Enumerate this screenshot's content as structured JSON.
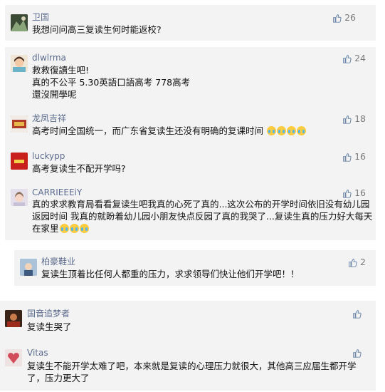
{
  "comments": [
    {
      "user": "卫国",
      "text": [
        "我想问问高三复读生何时能返校?"
      ],
      "likes": "26",
      "avatar": "user-avatar-weiguo"
    },
    {
      "user": "dlwlrma",
      "text": [
        "救救復讀生吧!",
        "真的不公平 5.30英語口語高考  778高考",
        "還沒開學呢"
      ],
      "likes": "24",
      "avatar": "user-avatar-dlwlrma"
    },
    {
      "user": "龙凤吉祥",
      "text": [
        "高考时间全国统一，而广东省复读生还没有明确的复课时间"
      ],
      "likes": "18",
      "emoji_count": 4,
      "avatar": "user-avatar-longfeng"
    },
    {
      "user": "luckypp",
      "text": [
        "高考复读生不配开学吗?"
      ],
      "likes": "16",
      "avatar": "user-avatar-luckypp"
    },
    {
      "user": "CARRIEEEiY",
      "text": [
        "真的求求教育局看看复读生吧我真的心死了真的...这次公布的开学时间依旧没有幼儿园",
        "返园时间 我真的就盼着幼儿园小朋友快点反园了真的我哭了...复读生真的压力好大每天",
        "在家里"
      ],
      "likes": "16",
      "emoji_count": 3,
      "avatar": "user-avatar-carrie"
    },
    {
      "user": "柏豪鞋业",
      "text": [
        "复读生顶着比任何人都重的压力，求求领导们快让他们开学吧！！"
      ],
      "likes": "2",
      "avatar": "user-avatar-baihao"
    },
    {
      "user": "国音追梦者",
      "text": [
        "复读生哭了"
      ],
      "likes": "",
      "avatar": "user-avatar-guoyin"
    },
    {
      "user": "Vitas",
      "text": [
        "复读生不能开学太难了吧，本来就是复读的心理压力就很大，其他高三应届生都开学",
        "了，压力更大了"
      ],
      "likes": "",
      "avatar": "user-avatar-vitas"
    }
  ],
  "colors": {
    "name": "#5c6c8e",
    "card": "#f3f3f3",
    "text": "#111111"
  }
}
